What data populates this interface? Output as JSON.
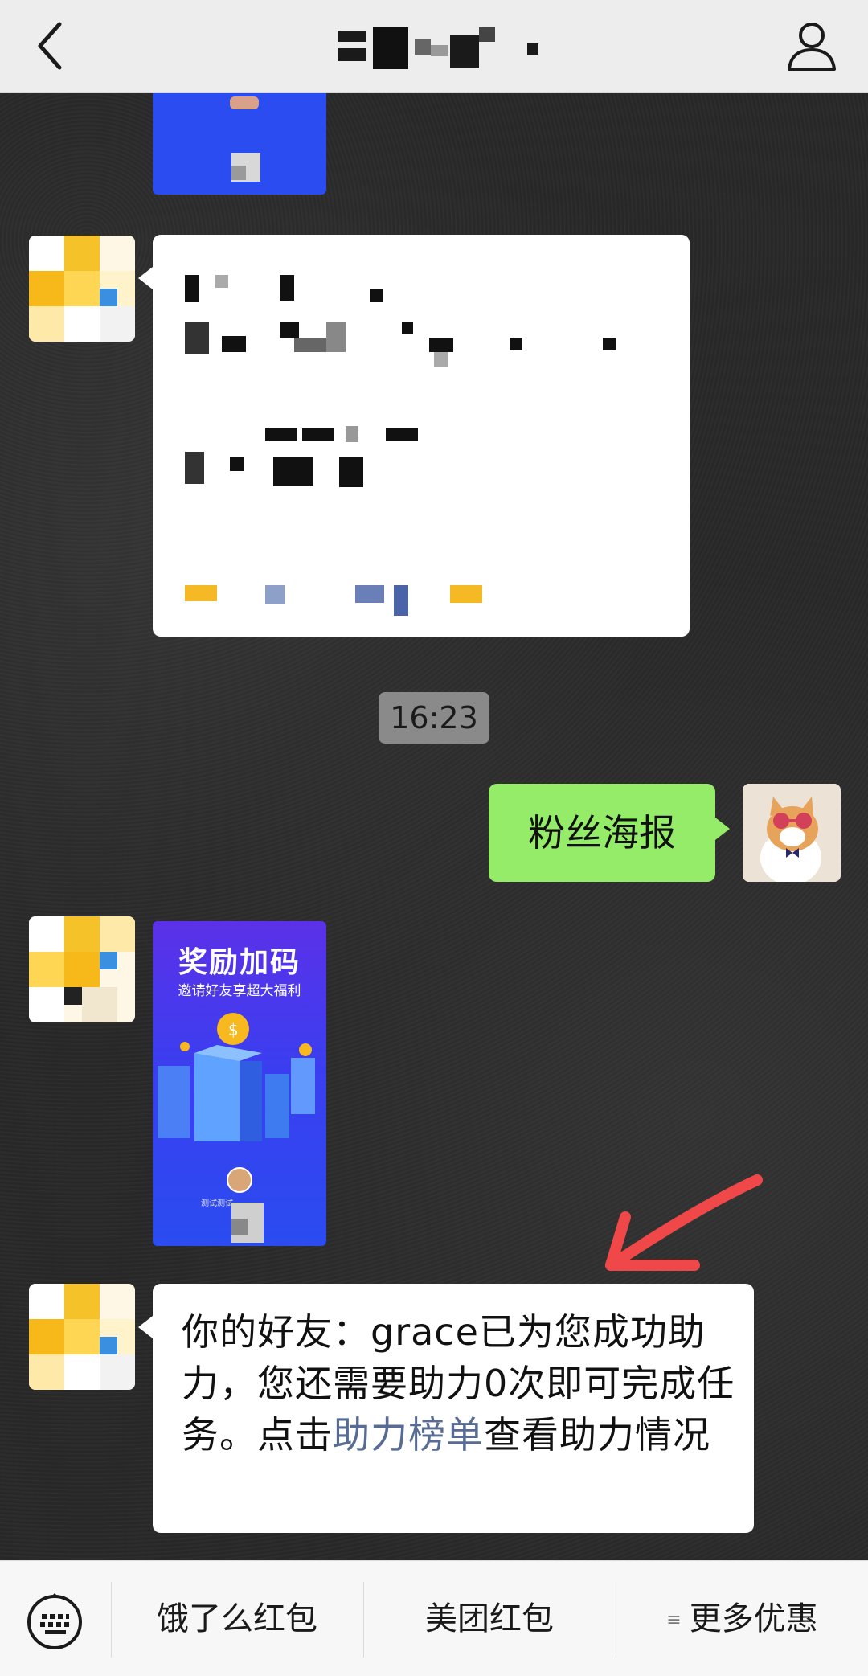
{
  "header": {
    "back_icon": "chevron-left-icon",
    "profile_icon": "person-icon"
  },
  "messages": {
    "timestamp": "16:23",
    "outgoing_text": "粉丝海报",
    "poster": {
      "title": "奖励加码",
      "subtitle": "邀请好友享超大福利",
      "footer": "测试测试"
    },
    "notice": {
      "part1": "你的好友：grace已为您成功助力，您还需要助力0次即可完成任务。点击",
      "link": "助力榜单",
      "part2": "查看助力情况"
    }
  },
  "menu": {
    "keyboard_icon": "keyboard-icon",
    "item1": "饿了么红包",
    "item2": "美团红包",
    "item3_icon": "menu-list-icon",
    "item3": "更多优惠"
  },
  "colors": {
    "bubble_green": "#95ec69",
    "link": "#576b95",
    "arrow_red": "#f04848"
  }
}
